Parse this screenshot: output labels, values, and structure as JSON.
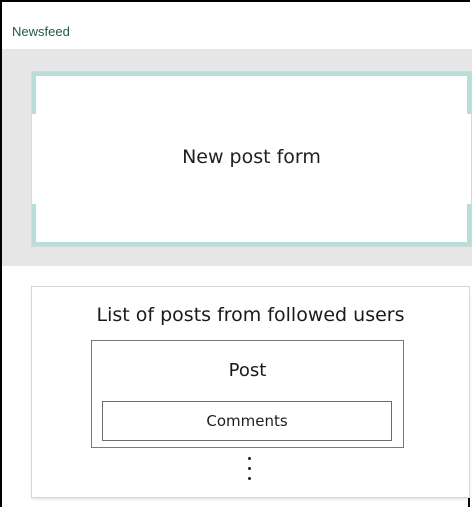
{
  "window": {
    "title": "Newsfeed"
  },
  "new_post_form": {
    "label": "New post form"
  },
  "posts_list": {
    "title": "List of posts from followed users",
    "post": {
      "label": "Post",
      "comments_label": "Comments"
    },
    "more_indicator": "more-vertical-icon"
  },
  "colors": {
    "title_green": "#1f5b3f",
    "form_accent": "#b9ddd8",
    "section_bg": "#e6e6e6"
  }
}
